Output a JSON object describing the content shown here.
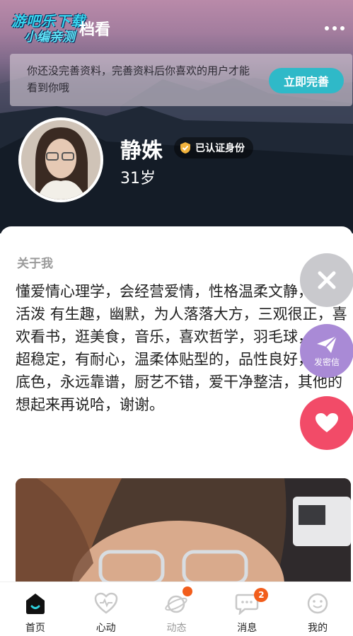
{
  "watermark": {
    "line1": "游吧乐下载",
    "line2": "小编亲测"
  },
  "header": {
    "title_partial": "档看",
    "more_icon": "more-dots-icon"
  },
  "profile_prompt": {
    "message": "你还没完善资料，完善资料后你喜欢的用户才能看到你哦",
    "button_label": "立即完善"
  },
  "user": {
    "name": "静姝",
    "verified_label": "已认证身份",
    "age": "31岁"
  },
  "about": {
    "title": "关于我",
    "text": "懂爱情心理学，会经营爱情，性格温柔文静，也可活泼 有生趣，幽默，为人落落大方，三观很正，喜欢看书，逛美食，音乐，喜欢哲学，羽毛球，情绪超稳定，有耐心，温柔体贴型的，品性良好，善良底色，永远靠谱，厨艺不错，爱干净整洁，其他的想起来再说哈，谢谢。"
  },
  "floating_actions": {
    "message_label": "发密信"
  },
  "bottom_nav": [
    {
      "label": "首页",
      "icon": "home-icon",
      "active": true
    },
    {
      "label": "心动",
      "icon": "heartbeat-icon",
      "active": false
    },
    {
      "label": "动态",
      "icon": "planet-icon",
      "active": false,
      "dot": true
    },
    {
      "label": "消息",
      "icon": "chat-icon",
      "active": false,
      "badge": "2"
    },
    {
      "label": "我的",
      "icon": "profile-icon",
      "active": false
    }
  ],
  "colors": {
    "accent": "#2fb9c8",
    "like": "#f24b68",
    "message": "#a98ad6",
    "badge": "#f25d1b"
  }
}
